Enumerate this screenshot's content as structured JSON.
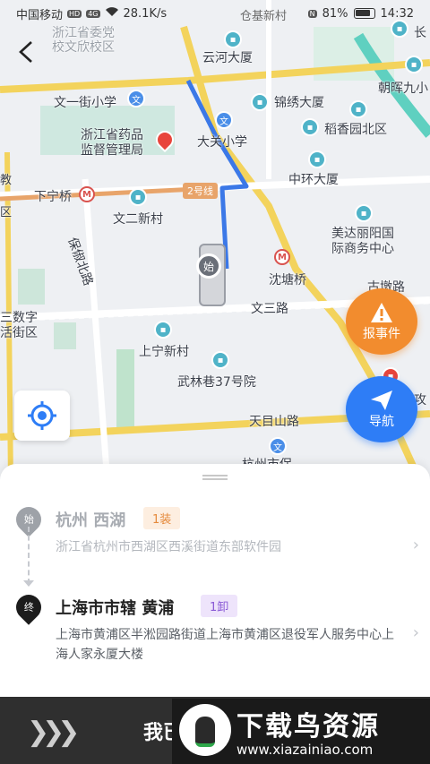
{
  "status_bar": {
    "carrier": "中国移动",
    "hd": "HD",
    "network": "4G",
    "speed": "28.1K/s",
    "ghost_text": "仓基新村",
    "nfc": "N",
    "battery": "81%",
    "time": "14:32"
  },
  "map": {
    "labels": {
      "zhejiang_party_school": "浙江省委党",
      "zhejiang_party_school_2": "校文欣校区",
      "yunhe": "云河大厦",
      "changxing": "长",
      "wenyi_street_school": "文一街小学",
      "jinxiu": "锦绣大厦",
      "zhaohui": "朝晖九小",
      "daoxiang": "稻香园北区",
      "drug_admin_1": "浙江省药品",
      "drug_admin_2": "监督管理局",
      "daguan_school": "大关小学",
      "zhonghuan": "中环大厦",
      "xianing_bridge": "下宁桥",
      "line2": "2号线",
      "wener_village": "文二新村",
      "meida": "美达丽阳国",
      "meida_2": "际商务中心",
      "baoshu_road": "保俶北路",
      "shentang_bridge": "沈塘桥",
      "wensan_road": "文三路",
      "gudun": "古墩路",
      "digital_street_1": "三数字",
      "digital_street_2": "活街区",
      "shangning": "上宁新村",
      "wulinxiang": "武林巷37号院",
      "tianmushan": "天目山路",
      "zheda": "杭州市保",
      "gongshu": "攻",
      "lang_left": "教",
      "lang_left_2": "区"
    }
  },
  "truck_marker": "始",
  "buttons": {
    "report": "报事件",
    "navigate": "导航"
  },
  "route": {
    "origin": {
      "pin": "始",
      "name": "杭州 西湖",
      "tag": "1装",
      "address": "浙江省杭州市西湖区西溪街道东部软件园"
    },
    "destination": {
      "pin": "终",
      "name": "上海市市辖 黄浦",
      "tag": "1卸",
      "address": "上海市黄浦区半淞园路街道上海市黄浦区退役军人服务中心上海人家永厦大楼"
    }
  },
  "bottom_bar": {
    "slide_label": "我已",
    "arrows": "❯❯❯"
  },
  "watermark": {
    "title": "下载鸟资源",
    "url": "www.xiazainiao.com"
  },
  "colors": {
    "route_blue": "#3b78e7",
    "report_orange": "#f28c2e",
    "navigate_blue": "#2e7df6",
    "load_tag": "#e58a3c",
    "unload_tag": "#8a5ad6"
  }
}
